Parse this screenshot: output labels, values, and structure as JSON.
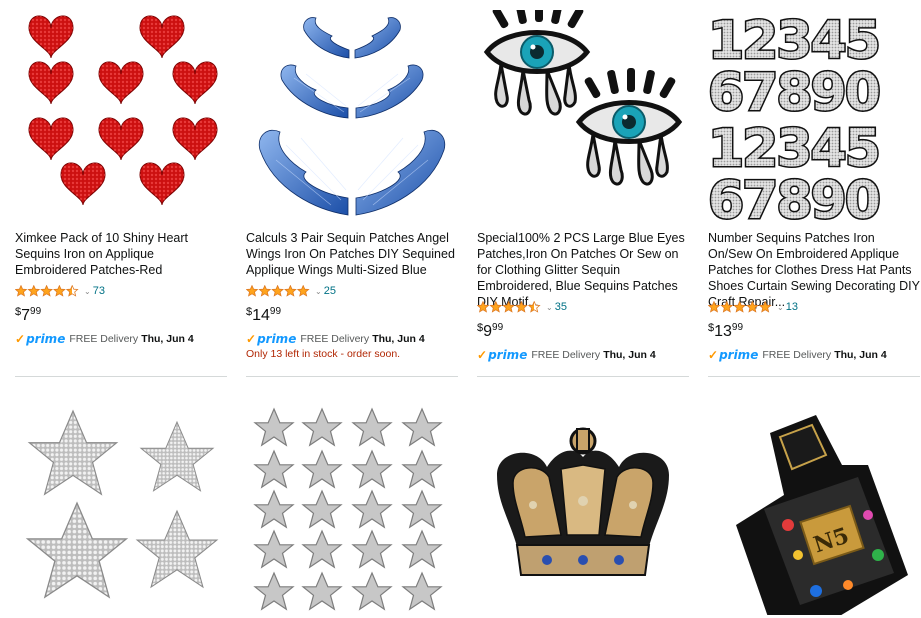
{
  "products": [
    {
      "image": "red-sequin-hearts",
      "title": "Ximkee Pack of 10 Shiny Heart Sequins Iron on Applique Embroidered Patches-Red",
      "stars": 4.5,
      "review_count": "73",
      "price": {
        "symbol": "$",
        "whole": "7",
        "fraction": "99"
      },
      "prime_label": "prime",
      "delivery_text": "FREE Delivery",
      "delivery_date": "Thu, Jun 4"
    },
    {
      "image": "blue-sequin-wings",
      "title": "Calculs 3 Pair Sequin Patches Angel Wings Iron On Patches DIY Sequined Applique Wings Multi-Sized Blue",
      "stars": 5,
      "review_count": "25",
      "price": {
        "symbol": "$",
        "whole": "14",
        "fraction": "99"
      },
      "prime_label": "prime",
      "delivery_text": "FREE Delivery",
      "delivery_date": "Thu, Jun 4",
      "stock_note": "Only 13 left in stock - order soon."
    },
    {
      "image": "blue-eye-patches",
      "title": "Special100% 2 PCS Large Blue Eyes Patches,Iron On Patches Or Sew on for Clothing Glitter Sequin Embroidered, Blue Sequins Patches DIY Motif...",
      "stars": 4.5,
      "review_count": "35",
      "price": {
        "symbol": "$",
        "whole": "9",
        "fraction": "99"
      },
      "prime_label": "prime",
      "delivery_text": "FREE Delivery",
      "delivery_date": "Thu, Jun 4"
    },
    {
      "image": "sequin-number-patches",
      "title": "Number Sequins Patches Iron On/Sew On Embroidered Applique Patches for Clothes Dress Hat Pants Shoes Curtain Sewing Decorating DIY Craft Repair...",
      "stars": 5,
      "review_count": "13",
      "price": {
        "symbol": "$",
        "whole": "13",
        "fraction": "99"
      },
      "prime_label": "prime",
      "delivery_text": "FREE Delivery",
      "delivery_date": "Thu, Jun 4",
      "image_text": [
        "12345",
        "67890",
        "12345",
        "67890"
      ]
    },
    {
      "image": "silver-rhinestone-stars"
    },
    {
      "image": "silver-embroidered-stars"
    },
    {
      "image": "gold-sequin-crown"
    },
    {
      "image": "perfume-bottle-patch",
      "image_text": "N5"
    }
  ],
  "colors": {
    "link": "#007185",
    "star": "#ffa41c",
    "prime_blue": "#1399ff",
    "prime_check": "#ff9900",
    "stock_red": "#b12704",
    "secondary_text": "#565959"
  }
}
